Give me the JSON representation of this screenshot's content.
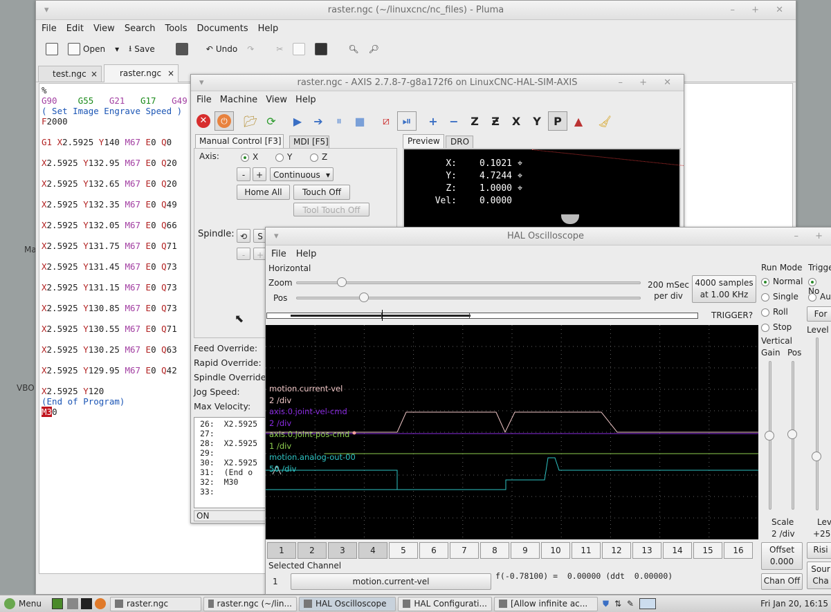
{
  "pluma": {
    "title": "raster.ngc (~/linuxcnc/nc_files) - Pluma",
    "menu": [
      "File",
      "Edit",
      "View",
      "Search",
      "Tools",
      "Documents",
      "Help"
    ],
    "toolbar": {
      "open": "Open",
      "save": "Save",
      "undo": "Undo"
    },
    "tabs": [
      "test.ngc",
      "raster.ngc"
    ],
    "lines": [
      [
        [
          "%",
          "#222"
        ]
      ],
      [
        [
          "G90",
          "#a23fa2"
        ],
        [
          "    G55",
          "#1a8a1a"
        ],
        [
          "   G21",
          "#a23fa2"
        ],
        [
          "   G17",
          "#1a8a1a"
        ],
        [
          "   G49",
          "#a23fa2"
        ]
      ],
      [
        [
          "( Set Image Engrave Speed )",
          "#1b55b5"
        ]
      ],
      [
        [
          "F",
          "#b22222"
        ],
        [
          "2000",
          "#222"
        ]
      ],
      [
        [
          "",
          ""
        ]
      ],
      [
        [
          "G1 ",
          "#b22222"
        ],
        [
          "X",
          "#b22222"
        ],
        [
          "2.5925 ",
          "#222"
        ],
        [
          "Y",
          "#b22222"
        ],
        [
          "140 ",
          "#222"
        ],
        [
          "M67 ",
          "#a23fa2"
        ],
        [
          "E",
          "#b22222"
        ],
        [
          "0 ",
          "#222"
        ],
        [
          "Q",
          "#b22222"
        ],
        [
          "0",
          "#222"
        ]
      ],
      [
        [
          "",
          ""
        ]
      ],
      [
        [
          "X",
          "#b22222"
        ],
        [
          "2.5925 ",
          "#222"
        ],
        [
          "Y",
          "#b22222"
        ],
        [
          "132.95 ",
          "#222"
        ],
        [
          "M67 ",
          "#a23fa2"
        ],
        [
          "E",
          "#b22222"
        ],
        [
          "0 ",
          "#222"
        ],
        [
          "Q",
          "#b22222"
        ],
        [
          "20",
          "#222"
        ]
      ],
      [
        [
          "",
          ""
        ]
      ],
      [
        [
          "X",
          "#b22222"
        ],
        [
          "2.5925 ",
          "#222"
        ],
        [
          "Y",
          "#b22222"
        ],
        [
          "132.65 ",
          "#222"
        ],
        [
          "M67 ",
          "#a23fa2"
        ],
        [
          "E",
          "#b22222"
        ],
        [
          "0 ",
          "#222"
        ],
        [
          "Q",
          "#b22222"
        ],
        [
          "20",
          "#222"
        ]
      ],
      [
        [
          "",
          ""
        ]
      ],
      [
        [
          "X",
          "#b22222"
        ],
        [
          "2.5925 ",
          "#222"
        ],
        [
          "Y",
          "#b22222"
        ],
        [
          "132.35 ",
          "#222"
        ],
        [
          "M67 ",
          "#a23fa2"
        ],
        [
          "E",
          "#b22222"
        ],
        [
          "0 ",
          "#222"
        ],
        [
          "Q",
          "#b22222"
        ],
        [
          "49",
          "#222"
        ]
      ],
      [
        [
          "",
          ""
        ]
      ],
      [
        [
          "X",
          "#b22222"
        ],
        [
          "2.5925 ",
          "#222"
        ],
        [
          "Y",
          "#b22222"
        ],
        [
          "132.05 ",
          "#222"
        ],
        [
          "M67 ",
          "#a23fa2"
        ],
        [
          "E",
          "#b22222"
        ],
        [
          "0 ",
          "#222"
        ],
        [
          "Q",
          "#b22222"
        ],
        [
          "66",
          "#222"
        ]
      ],
      [
        [
          "",
          ""
        ]
      ],
      [
        [
          "X",
          "#b22222"
        ],
        [
          "2.5925 ",
          "#222"
        ],
        [
          "Y",
          "#b22222"
        ],
        [
          "131.75 ",
          "#222"
        ],
        [
          "M67 ",
          "#a23fa2"
        ],
        [
          "E",
          "#b22222"
        ],
        [
          "0 ",
          "#222"
        ],
        [
          "Q",
          "#b22222"
        ],
        [
          "71",
          "#222"
        ]
      ],
      [
        [
          "",
          ""
        ]
      ],
      [
        [
          "X",
          "#b22222"
        ],
        [
          "2.5925 ",
          "#222"
        ],
        [
          "Y",
          "#b22222"
        ],
        [
          "131.45 ",
          "#222"
        ],
        [
          "M67 ",
          "#a23fa2"
        ],
        [
          "E",
          "#b22222"
        ],
        [
          "0 ",
          "#222"
        ],
        [
          "Q",
          "#b22222"
        ],
        [
          "73",
          "#222"
        ]
      ],
      [
        [
          "",
          ""
        ]
      ],
      [
        [
          "X",
          "#b22222"
        ],
        [
          "2.5925 ",
          "#222"
        ],
        [
          "Y",
          "#b22222"
        ],
        [
          "131.15 ",
          "#222"
        ],
        [
          "M67 ",
          "#a23fa2"
        ],
        [
          "E",
          "#b22222"
        ],
        [
          "0 ",
          "#222"
        ],
        [
          "Q",
          "#b22222"
        ],
        [
          "73",
          "#222"
        ]
      ],
      [
        [
          "",
          ""
        ]
      ],
      [
        [
          "X",
          "#b22222"
        ],
        [
          "2.5925 ",
          "#222"
        ],
        [
          "Y",
          "#b22222"
        ],
        [
          "130.85 ",
          "#222"
        ],
        [
          "M67 ",
          "#a23fa2"
        ],
        [
          "E",
          "#b22222"
        ],
        [
          "0 ",
          "#222"
        ],
        [
          "Q",
          "#b22222"
        ],
        [
          "73",
          "#222"
        ]
      ],
      [
        [
          "",
          ""
        ]
      ],
      [
        [
          "X",
          "#b22222"
        ],
        [
          "2.5925 ",
          "#222"
        ],
        [
          "Y",
          "#b22222"
        ],
        [
          "130.55 ",
          "#222"
        ],
        [
          "M67 ",
          "#a23fa2"
        ],
        [
          "E",
          "#b22222"
        ],
        [
          "0 ",
          "#222"
        ],
        [
          "Q",
          "#b22222"
        ],
        [
          "71",
          "#222"
        ]
      ],
      [
        [
          "",
          ""
        ]
      ],
      [
        [
          "X",
          "#b22222"
        ],
        [
          "2.5925 ",
          "#222"
        ],
        [
          "Y",
          "#b22222"
        ],
        [
          "130.25 ",
          "#222"
        ],
        [
          "M67 ",
          "#a23fa2"
        ],
        [
          "E",
          "#b22222"
        ],
        [
          "0 ",
          "#222"
        ],
        [
          "Q",
          "#b22222"
        ],
        [
          "63",
          "#222"
        ]
      ],
      [
        [
          "",
          ""
        ]
      ],
      [
        [
          "X",
          "#b22222"
        ],
        [
          "2.5925 ",
          "#222"
        ],
        [
          "Y",
          "#b22222"
        ],
        [
          "129.95 ",
          "#222"
        ],
        [
          "M67 ",
          "#a23fa2"
        ],
        [
          "E",
          "#b22222"
        ],
        [
          "0 ",
          "#222"
        ],
        [
          "Q",
          "#b22222"
        ],
        [
          "42",
          "#222"
        ]
      ],
      [
        [
          "",
          ""
        ]
      ],
      [
        [
          "X",
          "#b22222"
        ],
        [
          "2.5925 ",
          "#222"
        ],
        [
          "Y",
          "#b22222"
        ],
        [
          "120",
          "#222"
        ]
      ],
      [
        [
          "(End of Program)",
          "#1b55b5"
        ]
      ],
      [
        [
          "M3",
          "#fff"
        ],
        [
          "0",
          "#222"
        ]
      ]
    ]
  },
  "desktop": {
    "label_ma": "Ma",
    "label_vbo": "VBO"
  },
  "axis": {
    "title": "raster.ngc - AXIS 2.7.8-7-g8a172f6 on LinuxCNC-HAL-SIM-AXIS",
    "menu": [
      "File",
      "Machine",
      "View",
      "Help"
    ],
    "tabs": {
      "manual": "Manual Control [F3]",
      "mdi": "MDI [F5]",
      "preview": "Preview",
      "dro": "DRO"
    },
    "axis_label": "Axis:",
    "axes": [
      "X",
      "Y",
      "Z"
    ],
    "minus": "-",
    "plus": "+",
    "jog_mode": "Continuous",
    "home_all": "Home All",
    "touch_off": "Touch Off",
    "tool_touch_off": "Tool Touch Off",
    "spindle": "Spindle:",
    "spindle_s": "S",
    "overrides": [
      "Feed Override:",
      "Rapid Override:",
      "Spindle Override:",
      "Jog Speed:",
      "Max Velocity:"
    ],
    "dro": [
      [
        "X:",
        "0.1021"
      ],
      [
        "Y:",
        "4.7244"
      ],
      [
        "Z:",
        "1.0000"
      ],
      [
        "Vel:",
        "0.0000"
      ]
    ],
    "gcode_lines": [
      "26:  X2.5925",
      "27:",
      "28:  X2.5925",
      "29:",
      "30:  X2.5925",
      "31:  (End o",
      "32:  M30",
      "33:"
    ],
    "status": "ON"
  },
  "scope": {
    "title": "HAL Oscilloscope",
    "menu": [
      "File",
      "Help"
    ],
    "horizontal": "Horizontal",
    "zoom": "Zoom",
    "pos": "Pos",
    "rate": "200 mSec\nper div",
    "samples": "4000 samples\nat 1.00 KHz",
    "trigger_q": "TRIGGER?",
    "run_mode": "Run Mode",
    "modes": [
      "Normal",
      "Single",
      "Roll",
      "Stop"
    ],
    "trigger": "Trigge",
    "trig_opts": [
      "No",
      "Au"
    ],
    "force": "For",
    "vertical": "Vertical",
    "gain": "Gain",
    "vpos": "Pos",
    "level": "Level",
    "scale": "Scale",
    "scale_val": "2 /div",
    "level_lbl": "Lev",
    "level_val": "+25.",
    "offset": "Offset\n0.000",
    "rising": "Risi",
    "chan_off": "Chan Off",
    "source": "Sour\nCha",
    "channels": [
      "1",
      "2",
      "3",
      "4",
      "5",
      "6",
      "7",
      "8",
      "9",
      "10",
      "11",
      "12",
      "13",
      "14",
      "15",
      "16"
    ],
    "selected_channel": "Selected Channel",
    "sel_num": "1",
    "sel_name": "motion.current-vel",
    "readout": "f(-0.78100) =  0.00000 (ddt  0.00000)",
    "traces": [
      {
        "name": "motion.current-vel",
        "scale": "2 /div",
        "color": "#f2c8c8"
      },
      {
        "name": "axis.0.joint-vel-cmd",
        "scale": "2 /div",
        "color": "#8a2be2"
      },
      {
        "name": "axis.0.joint-pos-cmd",
        "scale": "1 /div",
        "color": "#8fd14f"
      },
      {
        "name": "motion.analog-out-00",
        "scale": "50 /div",
        "color": "#2ec4c4"
      }
    ]
  },
  "taskbar": {
    "menu": "Menu",
    "tasks": [
      "raster.ngc",
      "raster.ngc (~/lin...",
      "HAL Oscilloscope",
      "HAL Configurati...",
      "[Allow infinite ac..."
    ],
    "clock": "Fri Jan 20, 16:15"
  }
}
